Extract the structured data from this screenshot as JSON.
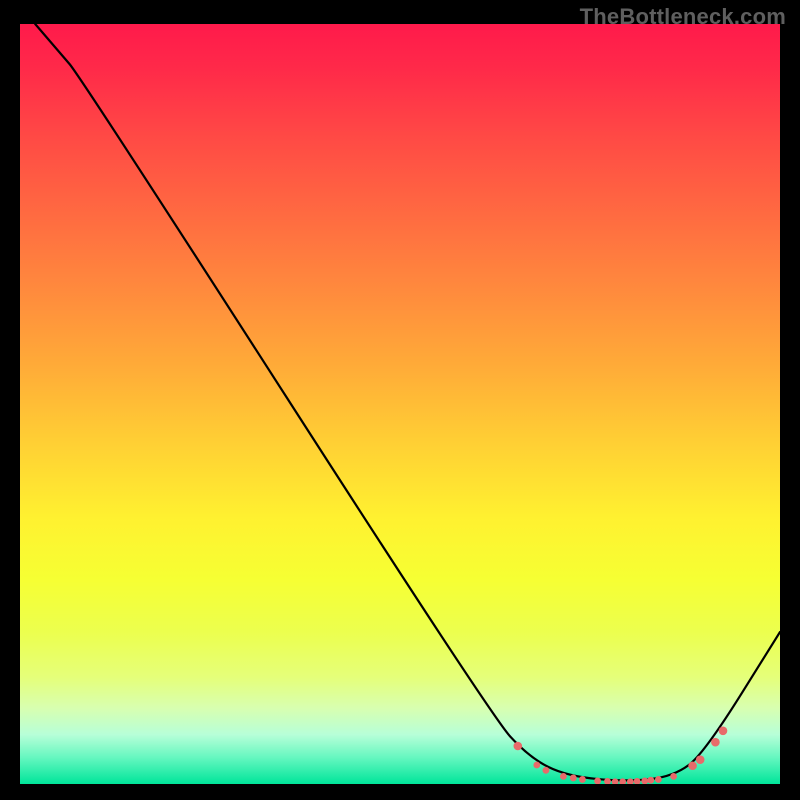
{
  "watermark": "TheBottleneck.com",
  "chart_data": {
    "type": "line",
    "title": "",
    "xlabel": "",
    "ylabel": "",
    "xlim": [
      0,
      100
    ],
    "ylim": [
      0,
      100
    ],
    "background_gradient": {
      "stops": [
        {
          "offset": 0.0,
          "color": "#ff1a4b"
        },
        {
          "offset": 0.06,
          "color": "#ff2a49"
        },
        {
          "offset": 0.15,
          "color": "#ff4a45"
        },
        {
          "offset": 0.25,
          "color": "#ff6a41"
        },
        {
          "offset": 0.35,
          "color": "#ff8a3d"
        },
        {
          "offset": 0.45,
          "color": "#ffab38"
        },
        {
          "offset": 0.55,
          "color": "#ffcf34"
        },
        {
          "offset": 0.65,
          "color": "#fff130"
        },
        {
          "offset": 0.73,
          "color": "#f6ff33"
        },
        {
          "offset": 0.8,
          "color": "#ecff4e"
        },
        {
          "offset": 0.86,
          "color": "#e5ff7a"
        },
        {
          "offset": 0.9,
          "color": "#d8ffb0"
        },
        {
          "offset": 0.935,
          "color": "#b7ffd8"
        },
        {
          "offset": 0.965,
          "color": "#66f7c0"
        },
        {
          "offset": 1.0,
          "color": "#00e59a"
        }
      ]
    },
    "series": [
      {
        "name": "curve",
        "color": "#000000",
        "x": [
          2.0,
          5.0,
          8.0,
          62.0,
          67.0,
          72.0,
          80.0,
          86.0,
          90.0,
          100.0
        ],
        "y": [
          100.0,
          96.5,
          93.0,
          9.0,
          3.5,
          1.0,
          0.3,
          1.0,
          4.0,
          20.0
        ]
      }
    ],
    "markers": {
      "color": "#e86a6a",
      "radius_small": 3.4,
      "radius_large": 4.3,
      "points": [
        {
          "x": 65.5,
          "y": 5.0,
          "r": "large"
        },
        {
          "x": 68.0,
          "y": 2.5,
          "r": "small"
        },
        {
          "x": 69.2,
          "y": 1.8,
          "r": "small"
        },
        {
          "x": 71.5,
          "y": 1.0,
          "r": "small"
        },
        {
          "x": 72.8,
          "y": 0.8,
          "r": "small"
        },
        {
          "x": 74.0,
          "y": 0.6,
          "r": "small"
        },
        {
          "x": 76.0,
          "y": 0.4,
          "r": "small"
        },
        {
          "x": 77.3,
          "y": 0.35,
          "r": "small"
        },
        {
          "x": 78.3,
          "y": 0.3,
          "r": "small"
        },
        {
          "x": 79.3,
          "y": 0.3,
          "r": "small"
        },
        {
          "x": 80.3,
          "y": 0.3,
          "r": "small"
        },
        {
          "x": 81.2,
          "y": 0.35,
          "r": "small"
        },
        {
          "x": 82.2,
          "y": 0.4,
          "r": "small"
        },
        {
          "x": 83.0,
          "y": 0.5,
          "r": "small"
        },
        {
          "x": 84.0,
          "y": 0.6,
          "r": "small"
        },
        {
          "x": 86.0,
          "y": 1.0,
          "r": "small"
        },
        {
          "x": 88.5,
          "y": 2.4,
          "r": "large"
        },
        {
          "x": 89.5,
          "y": 3.2,
          "r": "large"
        },
        {
          "x": 91.5,
          "y": 5.5,
          "r": "large"
        },
        {
          "x": 92.5,
          "y": 7.0,
          "r": "large"
        }
      ]
    }
  }
}
